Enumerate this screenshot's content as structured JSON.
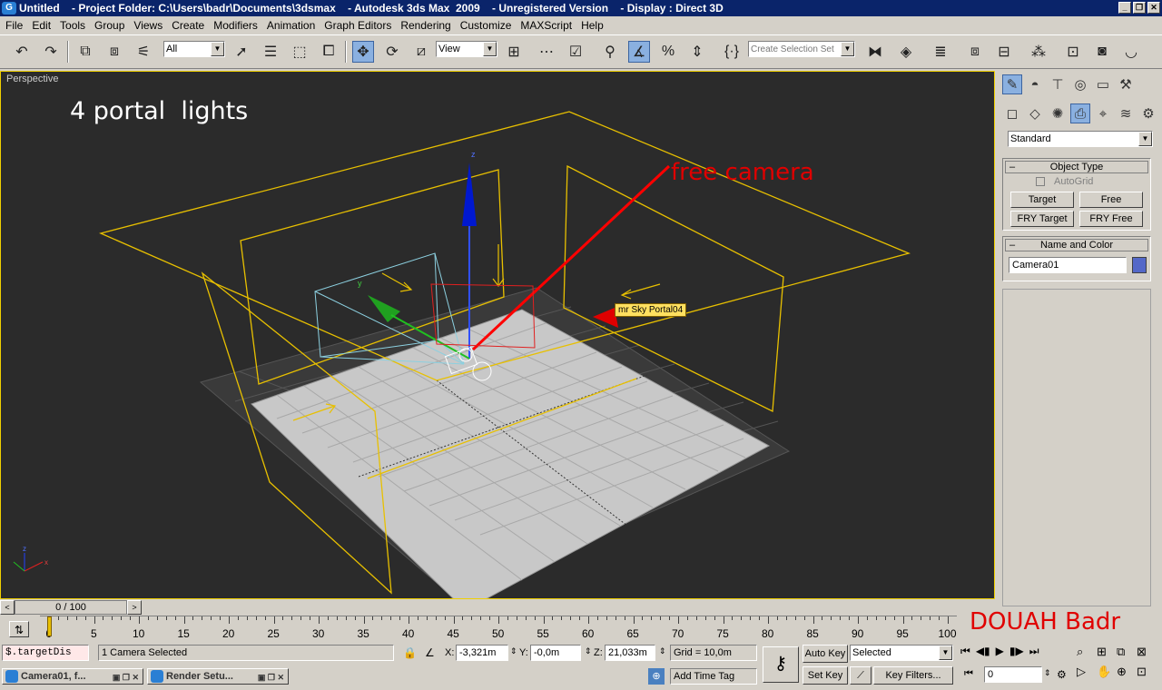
{
  "window": {
    "title": "Untitled    - Project Folder: C:\\Users\\badr\\Documents\\3dsmax    - Autodesk 3ds Max  2009    - Unregistered Version    - Display : Direct 3D",
    "app_icon": "G"
  },
  "menu": [
    "File",
    "Edit",
    "Tools",
    "Group",
    "Views",
    "Create",
    "Modifiers",
    "Animation",
    "Graph Editors",
    "Rendering",
    "Customize",
    "MAXScript",
    "Help"
  ],
  "toolbar": {
    "filter_value": "All",
    "coord_value": "View",
    "selection_set_placeholder": "Create Selection Set"
  },
  "viewport": {
    "label": "Perspective",
    "caption": "4 portal  lights",
    "camera_annotation": "free camera",
    "tooltip": "mr Sky Portal04",
    "axis_z": "z",
    "axis_y": "y",
    "gizmo_z": "z",
    "gizmo_x": "x"
  },
  "command_panel": {
    "category_value": "Standard",
    "object_type_title": "Object Type",
    "autogrid_label": "AutoGrid",
    "buttons": [
      "Target",
      "Free",
      "FRY Target",
      "FRY Free"
    ],
    "name_color_title": "Name and Color",
    "object_name": "Camera01",
    "object_color": "#5468c8"
  },
  "timeline": {
    "frame_display": "0 / 100",
    "ticks": [
      "0",
      "5",
      "10",
      "15",
      "20",
      "25",
      "30",
      "35",
      "40",
      "45",
      "50",
      "55",
      "60",
      "65",
      "70",
      "75",
      "80",
      "85",
      "90",
      "95",
      "100"
    ],
    "watermark": "DOUAH Badr"
  },
  "status": {
    "script_value": "$.targetDis",
    "selection_text": "1 Camera Selected",
    "x_label": "X:",
    "x_value": "-3,321m",
    "y_label": "Y:",
    "y_value": "-0,0m",
    "z_label": "Z:",
    "z_value": "21,033m",
    "grid_text": "Grid = 10,0m",
    "add_time_tag": "Add Time Tag",
    "auto_key": "Auto Key",
    "set_key": "Set Key",
    "selected_value": "Selected",
    "key_filters": "Key Filters...",
    "frame_value": "0"
  },
  "taskbar": [
    {
      "label": "Camera01, f..."
    },
    {
      "label": "Render Setu..."
    }
  ]
}
